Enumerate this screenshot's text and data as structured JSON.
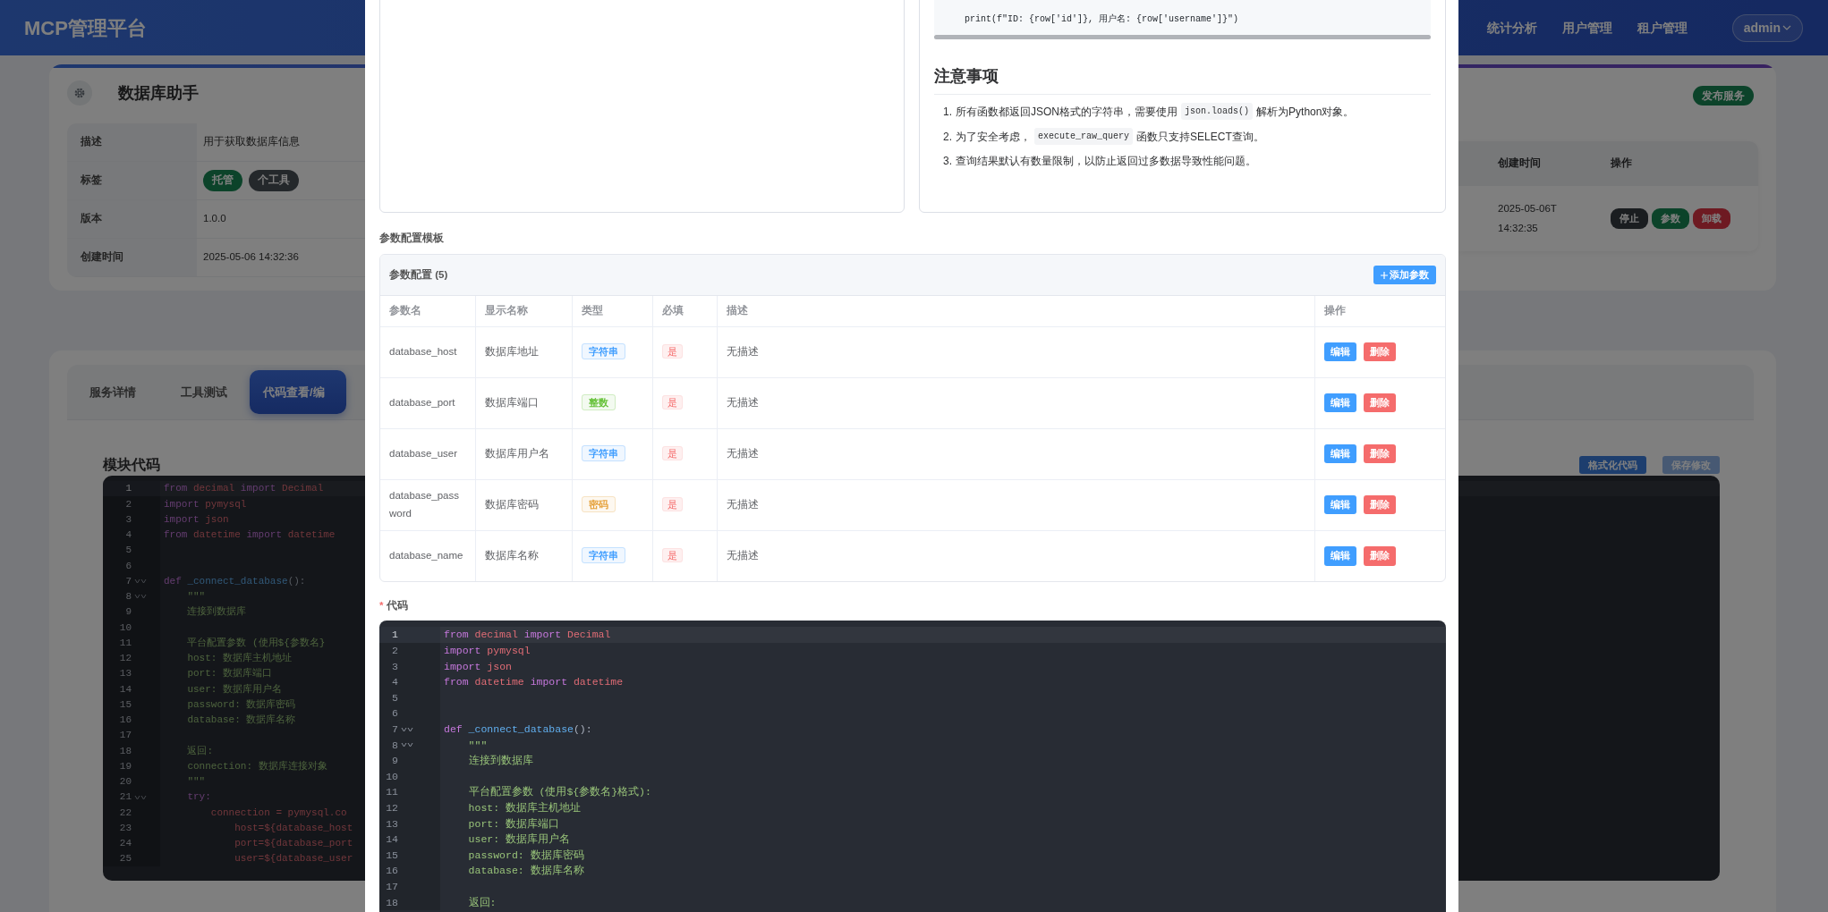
{
  "navbar": {
    "brand": "MCP管理平台",
    "links": [
      {
        "label": "统计分析"
      },
      {
        "label": "用户管理"
      },
      {
        "label": "租户管理"
      }
    ],
    "user_menu": "admin"
  },
  "service_card": {
    "title": "数据库助手",
    "info": [
      {
        "label": "描述",
        "value": "用于获取数据库信息"
      },
      {
        "label": "标签",
        "tags": [
          {
            "label": "托管",
            "kind": "success"
          },
          {
            "label": "个工具",
            "kind": "secondary"
          }
        ]
      },
      {
        "label": "版本",
        "value": "1.0.0"
      },
      {
        "label": "创建时间",
        "value": "2025-05-06 14:32:36"
      }
    ],
    "publish_button": "发布服务",
    "table": {
      "columns": [
        "创建时间",
        "操作"
      ],
      "rows": [
        {
          "created": "2025-05-06T14:32:35",
          "actions": [
            {
              "label": "停止",
              "kind": "dark"
            },
            {
              "label": "参数",
              "kind": "success"
            },
            {
              "label": "卸载",
              "kind": "danger"
            }
          ]
        }
      ]
    }
  },
  "detail_card": {
    "tabs": [
      {
        "label": "服务详情",
        "selected": false
      },
      {
        "label": "工具测试",
        "selected": false
      },
      {
        "label": "代码查看/编",
        "selected": true
      }
    ],
    "heading": "模块代码",
    "buttons": [
      {
        "label": "格式化代码",
        "disabled": false
      },
      {
        "label": "保存修改",
        "disabled": true
      }
    ],
    "editor": {
      "lines": [
        {
          "number": "1",
          "current": true,
          "fold": false,
          "tokens": [
            {
              "text": "from",
              "kind": "kw"
            },
            {
              "text": " decimal ",
              "kind": "name"
            },
            {
              "text": "import",
              "kind": "kw"
            },
            {
              "text": " Decimal",
              "kind": "name"
            }
          ]
        },
        {
          "number": "2",
          "current": false,
          "fold": false,
          "tokens": [
            {
              "text": "import",
              "kind": "kw"
            },
            {
              "text": " pymysql",
              "kind": "name"
            }
          ]
        },
        {
          "number": "3",
          "current": false,
          "fold": false,
          "tokens": [
            {
              "text": "import",
              "kind": "kw"
            },
            {
              "text": " json",
              "kind": "name"
            }
          ]
        },
        {
          "number": "4",
          "current": false,
          "fold": false,
          "tokens": [
            {
              "text": "from",
              "kind": "kw"
            },
            {
              "text": " datetime ",
              "kind": "name"
            },
            {
              "text": "import",
              "kind": "kw"
            },
            {
              "text": " datetime",
              "kind": "name"
            }
          ]
        },
        {
          "number": "5",
          "current": false,
          "fold": false
        },
        {
          "number": "6",
          "current": false,
          "fold": false
        },
        {
          "number": "7",
          "current": false,
          "fold": true,
          "tokens": [
            {
              "text": "def",
              "kind": "kw"
            },
            {
              "text": " _connect_database",
              "kind": "func"
            },
            {
              "text": "():",
              "kind": "plain"
            }
          ]
        },
        {
          "number": "8",
          "current": false,
          "fold": true,
          "tokens": [
            {
              "text": "    \"\"\"",
              "kind": "str"
            }
          ]
        },
        {
          "number": "9",
          "current": false,
          "fold": false,
          "tokens": [
            {
              "text": "    连接到数据库",
              "kind": "str"
            }
          ]
        },
        {
          "number": "10",
          "current": false,
          "fold": false
        },
        {
          "number": "11",
          "current": false,
          "fold": false,
          "tokens": [
            {
              "text": "    平台配置参数 (使用${参数名}",
              "kind": "str"
            }
          ]
        },
        {
          "number": "12",
          "current": false,
          "fold": false,
          "tokens": [
            {
              "text": "    host: 数据库主机地址",
              "kind": "str"
            }
          ]
        },
        {
          "number": "13",
          "current": false,
          "fold": false,
          "tokens": [
            {
              "text": "    port: 数据库端口",
              "kind": "str"
            }
          ]
        },
        {
          "number": "14",
          "current": false,
          "fold": false,
          "tokens": [
            {
              "text": "    user: 数据库用户名",
              "kind": "str"
            }
          ]
        },
        {
          "number": "15",
          "current": false,
          "fold": false,
          "tokens": [
            {
              "text": "    password: 数据库密码",
              "kind": "str"
            }
          ]
        },
        {
          "number": "16",
          "current": false,
          "fold": false,
          "tokens": [
            {
              "text": "    database: 数据库名称",
              "kind": "str"
            }
          ]
        },
        {
          "number": "17",
          "current": false,
          "fold": false
        },
        {
          "number": "18",
          "current": false,
          "fold": false,
          "tokens": [
            {
              "text": "    返回:",
              "kind": "str"
            }
          ]
        },
        {
          "number": "19",
          "current": false,
          "fold": false,
          "tokens": [
            {
              "text": "    connection: 数据库连接对象",
              "kind": "str"
            }
          ]
        },
        {
          "number": "20",
          "current": false,
          "fold": false,
          "tokens": [
            {
              "text": "    \"\"\"",
              "kind": "str"
            }
          ]
        },
        {
          "number": "21",
          "current": false,
          "fold": true,
          "tokens": [
            {
              "text": "    try:",
              "kind": "kw"
            }
          ]
        },
        {
          "number": "22",
          "current": false,
          "fold": false,
          "tokens": [
            {
              "text": "        connection = pymysql.co",
              "kind": "name"
            }
          ]
        },
        {
          "number": "23",
          "current": false,
          "fold": false,
          "tokens": [
            {
              "text": "            host=${database_host",
              "kind": "name"
            }
          ]
        },
        {
          "number": "24",
          "current": false,
          "fold": false,
          "tokens": [
            {
              "text": "            port=${database_port",
              "kind": "name"
            }
          ]
        },
        {
          "number": "25",
          "current": false,
          "fold": false,
          "tokens": [
            {
              "text": "            user=${database_user",
              "kind": "name"
            }
          ]
        }
      ]
    }
  },
  "modal": {
    "example_code": "    print(f\"ID: {row['id']}, 用户名: {row['username']}\")",
    "notes_title": "注意事项",
    "notes": [
      {
        "number": "1.",
        "text_before": "所有函数都返回JSON格式的字符串，需要使用 ",
        "code": "json.loads()",
        "text_after": " 解析为Python对象。"
      },
      {
        "number": "2.",
        "text_before": "为了安全考虑， ",
        "code": "execute_raw_query",
        "text_after": " 函数只支持SELECT查询。"
      },
      {
        "number": "3.",
        "text_before": "查询结果默认有数量限制，以防止返回过多数据导致性能问题。"
      }
    ],
    "params_label": "参数配置模板",
    "params": {
      "title": "参数配置 (5)",
      "add_button": "添加参数",
      "columns": [
        "参数名",
        "显示名称",
        "类型",
        "必填",
        "描述",
        "操作"
      ],
      "rows": [
        {
          "name": "database_host",
          "display": "数据库地址",
          "type": {
            "label": "字符串",
            "color": "#409eff"
          },
          "required": "是",
          "description": "无描述",
          "edit": "编辑",
          "delete": "删除"
        },
        {
          "name": "database_port",
          "display": "数据库端口",
          "type": {
            "label": "整数",
            "color": "#67c23a"
          },
          "required": "是",
          "description": "无描述",
          "edit": "编辑",
          "delete": "删除"
        },
        {
          "name": "database_user",
          "display": "数据库用户名",
          "type": {
            "label": "字符串",
            "color": "#409eff"
          },
          "required": "是",
          "description": "无描述",
          "edit": "编辑",
          "delete": "删除"
        },
        {
          "name": "database_password",
          "display": "数据库密码",
          "type": {
            "label": "密码",
            "color": "#e6a23c"
          },
          "required": "是",
          "description": "无描述",
          "edit": "编辑",
          "delete": "删除"
        },
        {
          "name": "database_name",
          "display": "数据库名称",
          "type": {
            "label": "字符串",
            "color": "#409eff"
          },
          "required": "是",
          "description": "无描述",
          "edit": "编辑",
          "delete": "删除"
        }
      ]
    },
    "required_mark": "*",
    "code_label": "代码",
    "editor": {
      "lines": [
        {
          "number": "1",
          "current": true,
          "fold": false,
          "tokens": [
            {
              "text": "from",
              "kind": "kw"
            },
            {
              "text": " decimal ",
              "kind": "name"
            },
            {
              "text": "import",
              "kind": "kw"
            },
            {
              "text": " Decimal",
              "kind": "name"
            }
          ]
        },
        {
          "number": "2",
          "current": false,
          "fold": false,
          "tokens": [
            {
              "text": "import",
              "kind": "kw"
            },
            {
              "text": " pymysql",
              "kind": "name"
            }
          ]
        },
        {
          "number": "3",
          "current": false,
          "fold": false,
          "tokens": [
            {
              "text": "import",
              "kind": "kw"
            },
            {
              "text": " json",
              "kind": "name"
            }
          ]
        },
        {
          "number": "4",
          "current": false,
          "fold": false,
          "tokens": [
            {
              "text": "from",
              "kind": "kw"
            },
            {
              "text": " datetime ",
              "kind": "name"
            },
            {
              "text": "import",
              "kind": "kw"
            },
            {
              "text": " datetime",
              "kind": "name"
            }
          ]
        },
        {
          "number": "5",
          "current": false,
          "fold": false
        },
        {
          "number": "6",
          "current": false,
          "fold": false
        },
        {
          "number": "7",
          "current": false,
          "fold": true,
          "tokens": [
            {
              "text": "def",
              "kind": "kw"
            },
            {
              "text": " _connect_database",
              "kind": "func"
            },
            {
              "text": "():",
              "kind": "plain"
            }
          ]
        },
        {
          "number": "8",
          "current": false,
          "fold": true,
          "tokens": [
            {
              "text": "    \"\"\"",
              "kind": "str"
            }
          ]
        },
        {
          "number": "9",
          "current": false,
          "fold": false,
          "tokens": [
            {
              "text": "    连接到数据库",
              "kind": "str"
            }
          ]
        },
        {
          "number": "10",
          "current": false,
          "fold": false
        },
        {
          "number": "11",
          "current": false,
          "fold": false,
          "tokens": [
            {
              "text": "    平台配置参数 (使用${参数名}格式):",
              "kind": "str"
            }
          ]
        },
        {
          "number": "12",
          "current": false,
          "fold": false,
          "tokens": [
            {
              "text": "    host: 数据库主机地址",
              "kind": "str"
            }
          ]
        },
        {
          "number": "13",
          "current": false,
          "fold": false,
          "tokens": [
            {
              "text": "    port: 数据库端口",
              "kind": "str"
            }
          ]
        },
        {
          "number": "14",
          "current": false,
          "fold": false,
          "tokens": [
            {
              "text": "    user: 数据库用户名",
              "kind": "str"
            }
          ]
        },
        {
          "number": "15",
          "current": false,
          "fold": false,
          "tokens": [
            {
              "text": "    password: 数据库密码",
              "kind": "str"
            }
          ]
        },
        {
          "number": "16",
          "current": false,
          "fold": false,
          "tokens": [
            {
              "text": "    database: 数据库名称",
              "kind": "str"
            }
          ]
        },
        {
          "number": "17",
          "current": false,
          "fold": false
        },
        {
          "number": "18",
          "current": false,
          "fold": false,
          "tokens": [
            {
              "text": "    返回:",
              "kind": "str"
            }
          ]
        }
      ]
    }
  }
}
